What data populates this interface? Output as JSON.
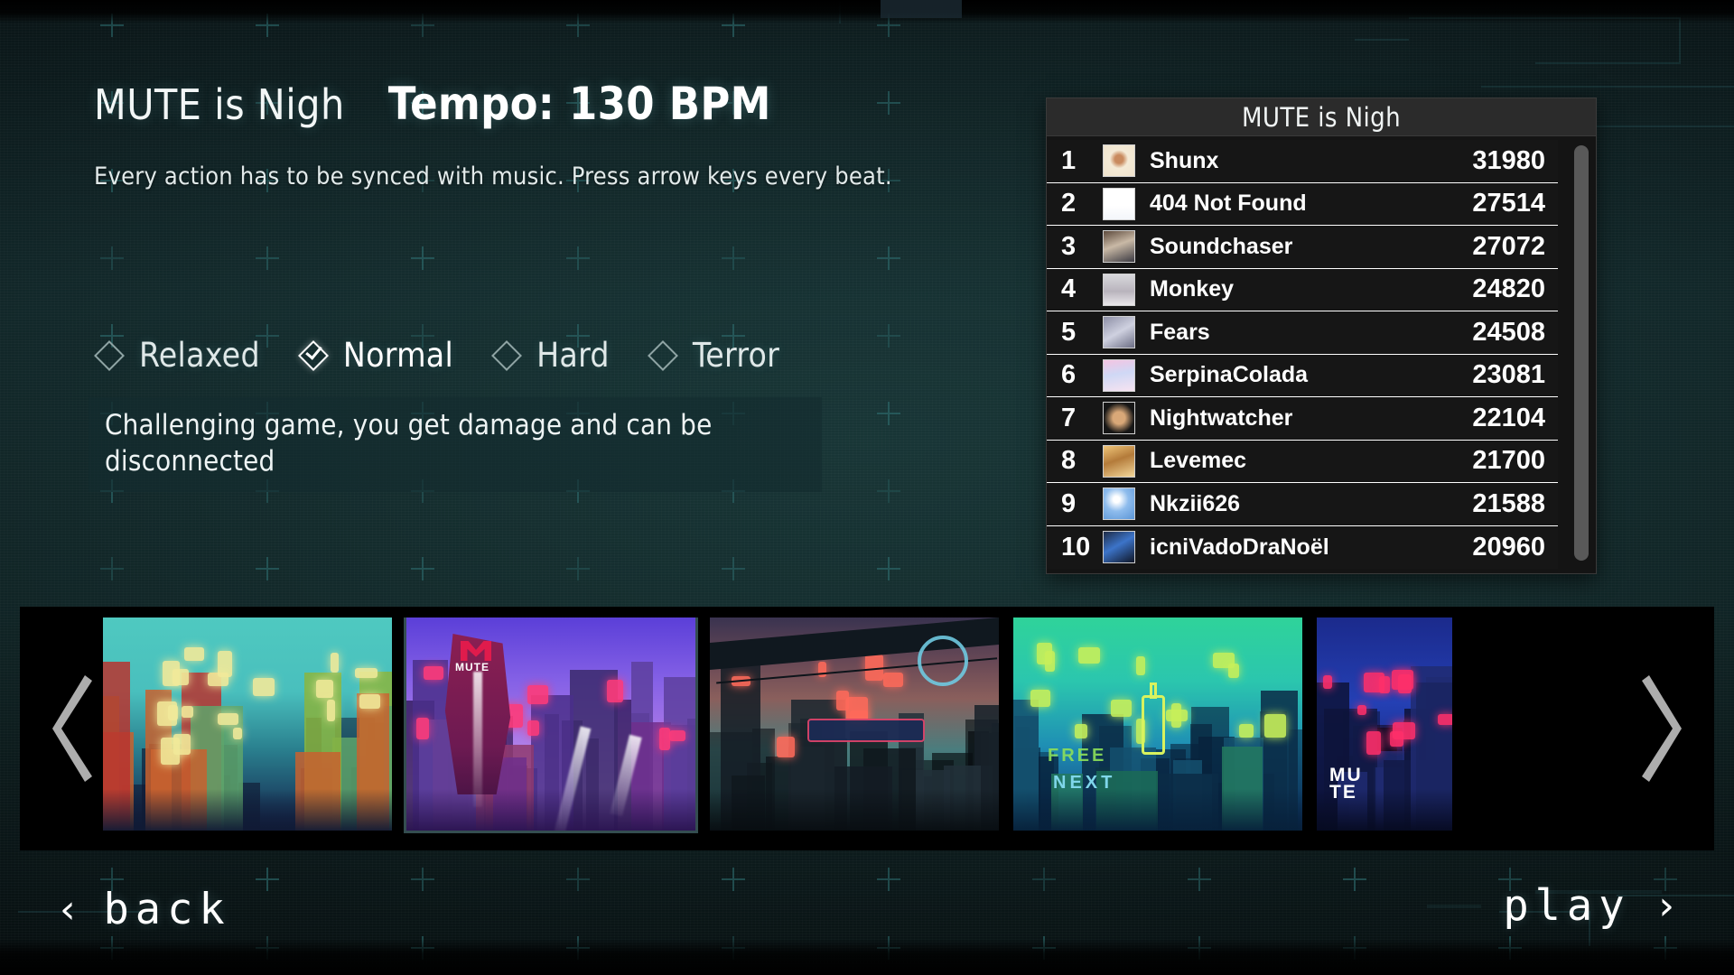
{
  "header": {
    "song_title": "MUTE is Nigh",
    "tempo_label": "Tempo: 130 BPM",
    "subtitle": "Every action has to be synced with music. Press arrow keys every beat."
  },
  "difficulty": {
    "options": [
      {
        "label": "Relaxed",
        "selected": false
      },
      {
        "label": "Normal",
        "selected": true
      },
      {
        "label": "Hard",
        "selected": false
      },
      {
        "label": "Terror",
        "selected": false
      }
    ],
    "selected_label": "Normal",
    "description": "Challenging game, you get damage and can be disconnected"
  },
  "leaderboard": {
    "title": "MUTE is Nigh",
    "columns": [
      "rank",
      "avatar",
      "name",
      "score"
    ],
    "rows": [
      {
        "rank": "1",
        "name": "Shunx",
        "score": "31980"
      },
      {
        "rank": "2",
        "name": "404 Not Found",
        "score": "27514"
      },
      {
        "rank": "3",
        "name": "Soundchaser",
        "score": "27072"
      },
      {
        "rank": "4",
        "name": "Monkey",
        "score": "24820"
      },
      {
        "rank": "5",
        "name": "Fears",
        "score": "24508"
      },
      {
        "rank": "6",
        "name": "SerpinaColada",
        "score": "23081"
      },
      {
        "rank": "7",
        "name": "Nightwatcher",
        "score": "22104"
      },
      {
        "rank": "8",
        "name": "Levemec",
        "score": "21700"
      },
      {
        "rank": "9",
        "name": "Nkzii626",
        "score": "21588"
      },
      {
        "rank": "10",
        "name": "icniVadoDraNoël",
        "score": "20960"
      }
    ]
  },
  "carousel": {
    "prev_icon": "chevron-left-icon",
    "next_icon": "chevron-right-icon",
    "levels": [
      {
        "caption": "",
        "selected": false
      },
      {
        "caption": "MUTE",
        "selected": true
      },
      {
        "caption": "",
        "selected": false
      },
      {
        "caption": "NEXT",
        "selected": false
      },
      {
        "caption": "MUTE",
        "selected": false
      }
    ]
  },
  "footer": {
    "back_label": "back",
    "back_chevron": "‹",
    "play_label": "play",
    "play_chevron": "›"
  },
  "colors": {
    "background_teal": "#13292b",
    "accent_cross": "#2e6e70",
    "panel_dark": "#141414",
    "panel_header": "#2b2b2b",
    "text_primary": "#ffffff",
    "scrollbar": "#595959"
  }
}
